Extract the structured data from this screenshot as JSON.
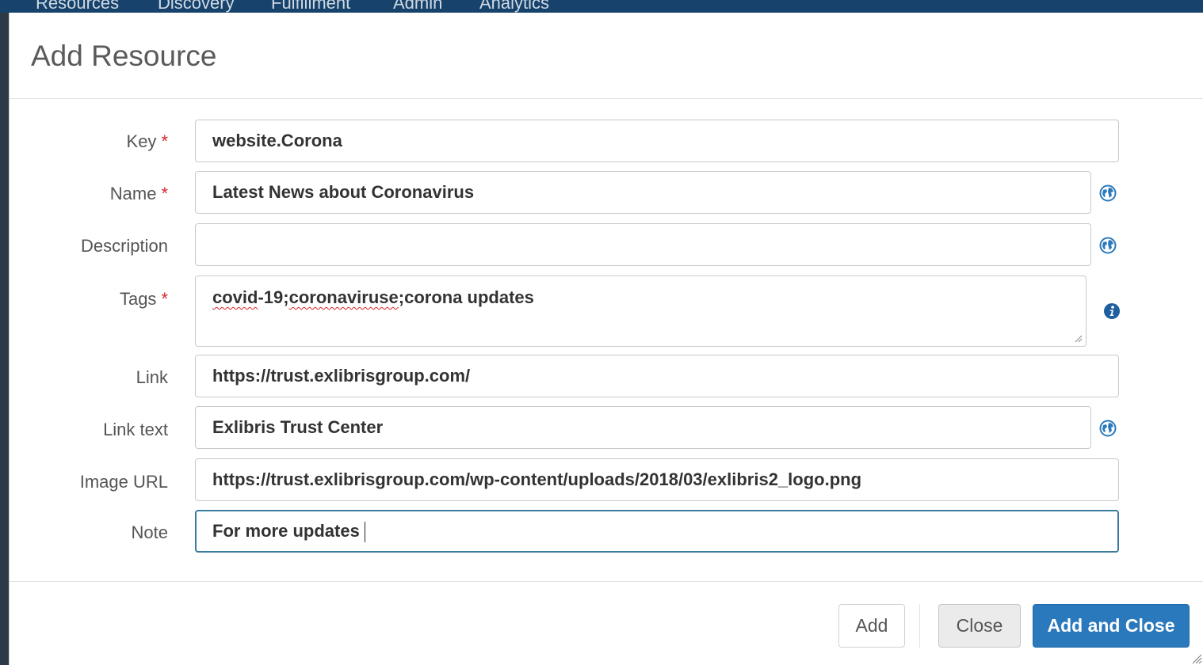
{
  "app_nav": {
    "items": [
      "Resources",
      "Discovery",
      "Fulfillment",
      "Admin",
      "Analytics"
    ]
  },
  "modal": {
    "title": "Add Resource"
  },
  "form": {
    "required_marker": "*",
    "key": {
      "label": "Key",
      "value": "website.Corona",
      "required": true
    },
    "name": {
      "label": "Name",
      "value": "Latest News about Coronavirus",
      "required": true,
      "icon": "globe-icon"
    },
    "description": {
      "label": "Description",
      "value": "",
      "required": false,
      "icon": "globe-icon"
    },
    "tags": {
      "label": "Tags",
      "value": "covid-19;coronaviruse;corona updates",
      "value_parts": [
        "covid",
        "-19;",
        "coronaviruse",
        ";corona updates"
      ],
      "required": true,
      "icon": "info-icon"
    },
    "link": {
      "label": "Link",
      "value": "https://trust.exlibrisgroup.com/",
      "required": false
    },
    "link_text": {
      "label": "Link text",
      "value": "Exlibris Trust Center",
      "required": false,
      "icon": "globe-icon"
    },
    "image_url": {
      "label": "Image URL",
      "value": "https://trust.exlibrisgroup.com/wp-content/uploads/2018/03/exlibris2_logo.png",
      "required": false
    },
    "note": {
      "label": "Note",
      "value": "For more updates",
      "required": false,
      "focused": true
    }
  },
  "footer": {
    "add_label": "Add",
    "close_label": "Close",
    "add_close_label": "Add and Close"
  },
  "colors": {
    "primary": "#2a79bd",
    "required": "#d9262a",
    "focus_border": "#3a7ca0",
    "icon_blue": "#2a79bd"
  }
}
